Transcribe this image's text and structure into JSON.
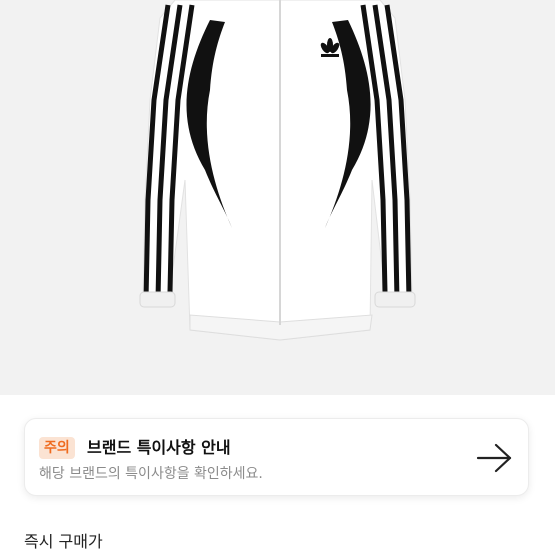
{
  "product": {
    "image_icon": "jacket-product-image"
  },
  "notice": {
    "badge": "주의",
    "title": "브랜드 특이사항 안내",
    "description": "해당 브랜드의 특이사항을 확인하세요.",
    "arrow_icon": "arrow-right-icon"
  },
  "purchase": {
    "label": "즉시 구매가"
  },
  "colors": {
    "background": "#f2f2f2",
    "badge_bg": "#fbe3d3",
    "badge_text": "#ef6b1f"
  }
}
